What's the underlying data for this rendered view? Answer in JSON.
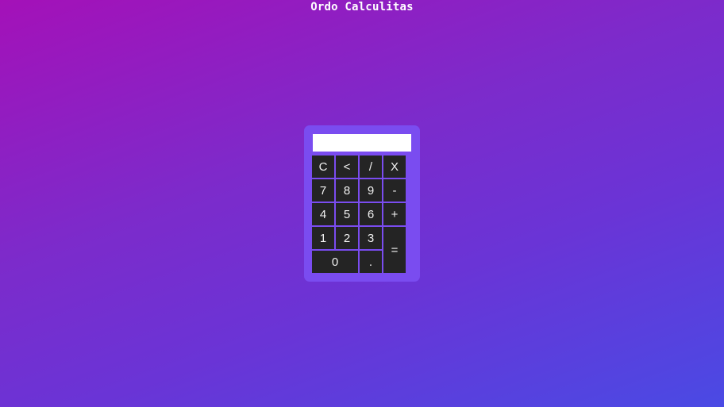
{
  "page": {
    "title": "Ordo Calculitas"
  },
  "calculator": {
    "display_value": "",
    "keys": {
      "clear": "C",
      "backspace": "<",
      "divide": "/",
      "multiply": "X",
      "seven": "7",
      "eight": "8",
      "nine": "9",
      "minus": "-",
      "four": "4",
      "five": "5",
      "six": "6",
      "plus": "+",
      "one": "1",
      "two": "2",
      "three": "3",
      "equals": "=",
      "zero": "0",
      "dot": "."
    }
  },
  "colors": {
    "background_gradient_start": "#a411b8",
    "background_gradient_end": "#4a4ae4",
    "calculator_body": "#7a4cf0",
    "key_background": "#242424",
    "key_text": "#f2f2f2",
    "display_background": "#ffffff"
  }
}
